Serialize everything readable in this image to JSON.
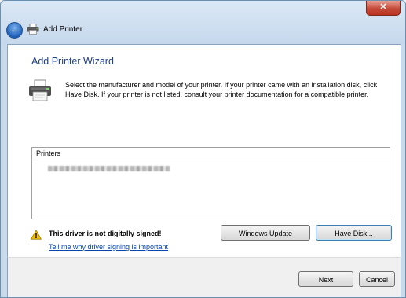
{
  "window": {
    "title": "Add Printer",
    "close_glyph": "✕"
  },
  "wizard": {
    "title": "Add Printer Wizard",
    "description": "Select the manufacturer and model of your printer. If your printer came with an installation disk, click Have Disk. If your printer is not listed, consult your printer documentation for a compatible printer."
  },
  "printers": {
    "header": "Printers",
    "items": [
      {
        "redacted": true
      }
    ]
  },
  "warning": {
    "text": "This driver is not digitally signed!",
    "link": "Tell me why driver signing is important"
  },
  "buttons": {
    "windows_update": "Windows Update",
    "have_disk": "Have Disk...",
    "next": "Next",
    "cancel": "Cancel"
  },
  "icons": {
    "back": "back-arrow-icon",
    "printer": "printer-icon",
    "warning": "warning-icon"
  },
  "colors": {
    "title_blue": "#1e3f8b",
    "link_blue": "#0645ad",
    "warning_yellow": "#f5c400"
  }
}
